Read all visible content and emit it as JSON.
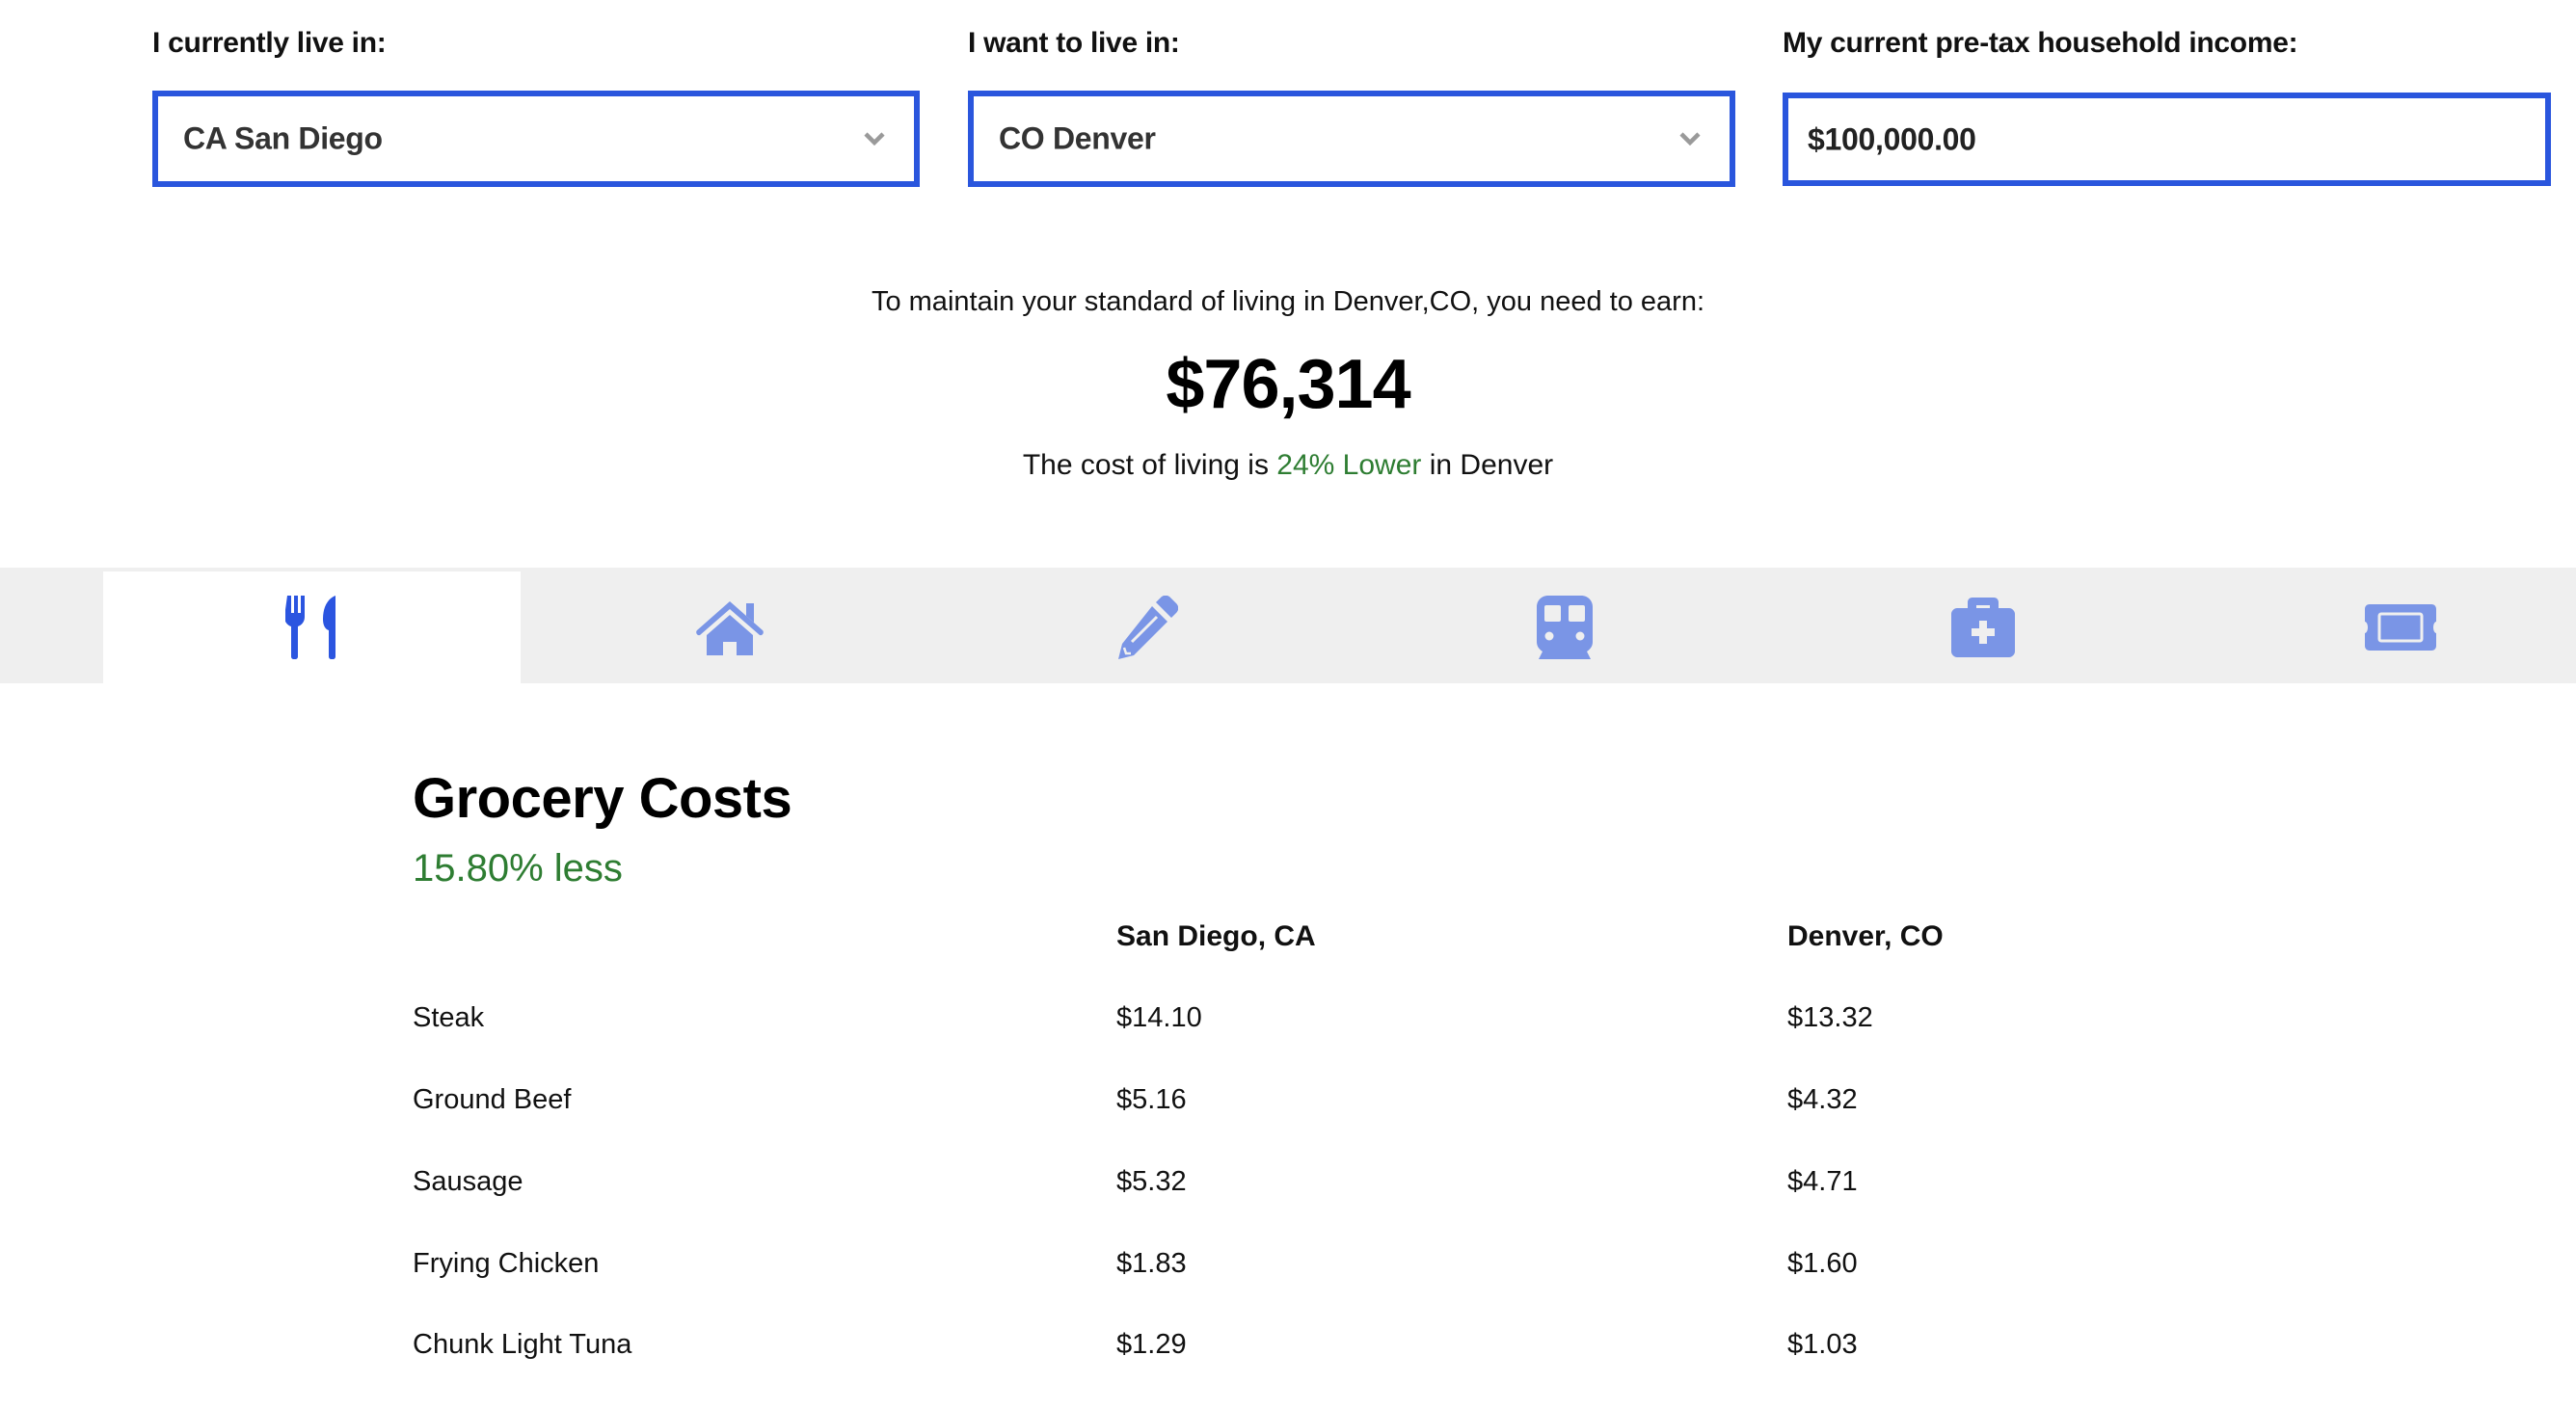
{
  "form": {
    "current_city": {
      "label": "I currently live in:",
      "value": "CA San Diego"
    },
    "target_city": {
      "label": "I want to live in:",
      "value": "CO Denver"
    },
    "income": {
      "label": "My current pre-tax household income:",
      "value": "$100,000.00"
    }
  },
  "result": {
    "subtitle": "To maintain your standard of living in Denver,CO, you need to earn:",
    "amount": "$76,314",
    "cost_prefix": "The cost of living is ",
    "cost_change": "24% Lower",
    "cost_suffix": " in Denver"
  },
  "tabs": [
    {
      "name": "grocery",
      "icon": "fork-knife-icon",
      "active": true
    },
    {
      "name": "housing",
      "icon": "home-icon",
      "active": false
    },
    {
      "name": "utilities",
      "icon": "pencil-icon",
      "active": false
    },
    {
      "name": "transportation",
      "icon": "train-icon",
      "active": false
    },
    {
      "name": "healthcare",
      "icon": "medical-kit-icon",
      "active": false
    },
    {
      "name": "entertainment",
      "icon": "ticket-icon",
      "active": false
    }
  ],
  "section": {
    "title": "Grocery Costs",
    "delta": "15.80% less",
    "columns": [
      "",
      "San Diego, CA",
      "Denver, CO"
    ],
    "rows": [
      [
        "Steak",
        "$14.10",
        "$13.32"
      ],
      [
        "Ground Beef",
        "$5.16",
        "$4.32"
      ],
      [
        "Sausage",
        "$5.32",
        "$4.71"
      ],
      [
        "Frying Chicken",
        "$1.83",
        "$1.60"
      ],
      [
        "Chunk Light Tuna",
        "$1.29",
        "$1.03"
      ]
    ]
  },
  "colors": {
    "accent": "#2a56dd",
    "active_icon": "#2b55e0",
    "inactive_icon": "#7a95e6",
    "positive": "#2e7d32",
    "tabbar_bg": "#efefef"
  }
}
